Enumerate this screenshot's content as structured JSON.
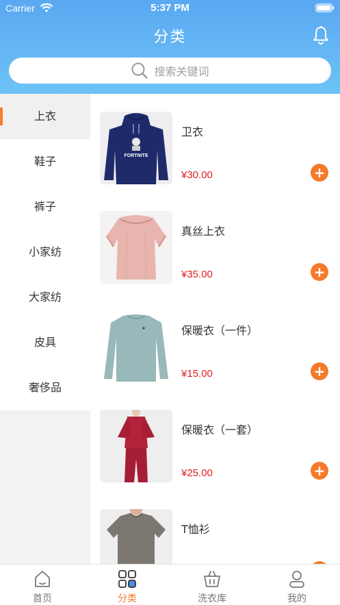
{
  "status_bar": {
    "carrier": "Carrier",
    "time": "5:37 PM"
  },
  "nav": {
    "title": "分类"
  },
  "search": {
    "placeholder": "搜索关键词"
  },
  "sidebar": {
    "items": [
      {
        "label": "上衣",
        "active": true
      },
      {
        "label": "鞋子",
        "active": false
      },
      {
        "label": "裤子",
        "active": false
      },
      {
        "label": "小家纺",
        "active": false
      },
      {
        "label": "大家纺",
        "active": false
      },
      {
        "label": "皮具",
        "active": false
      },
      {
        "label": "奢侈品",
        "active": false
      }
    ]
  },
  "products": [
    {
      "name": "卫衣",
      "price": "¥30.00",
      "image": "navy-hoodie"
    },
    {
      "name": "真丝上衣",
      "price": "¥35.00",
      "image": "pink-silk-blouse"
    },
    {
      "name": "保暖衣（一件）",
      "price": "¥15.00",
      "image": "teal-thermal-top"
    },
    {
      "name": "保暖衣（一套）",
      "price": "¥25.00",
      "image": "red-thermal-set"
    },
    {
      "name": "T恤衫",
      "price": "",
      "image": "grey-tshirt"
    }
  ],
  "tabbar": {
    "items": [
      {
        "label": "首页",
        "icon": "home-icon",
        "active": false
      },
      {
        "label": "分类",
        "icon": "category-icon",
        "active": true
      },
      {
        "label": "洗衣库",
        "icon": "basket-icon",
        "active": false
      },
      {
        "label": "我的",
        "icon": "profile-icon",
        "active": false
      }
    ]
  },
  "colors": {
    "accent": "#f47a2a",
    "header": "#5aa8f2",
    "price": "#e02020"
  }
}
